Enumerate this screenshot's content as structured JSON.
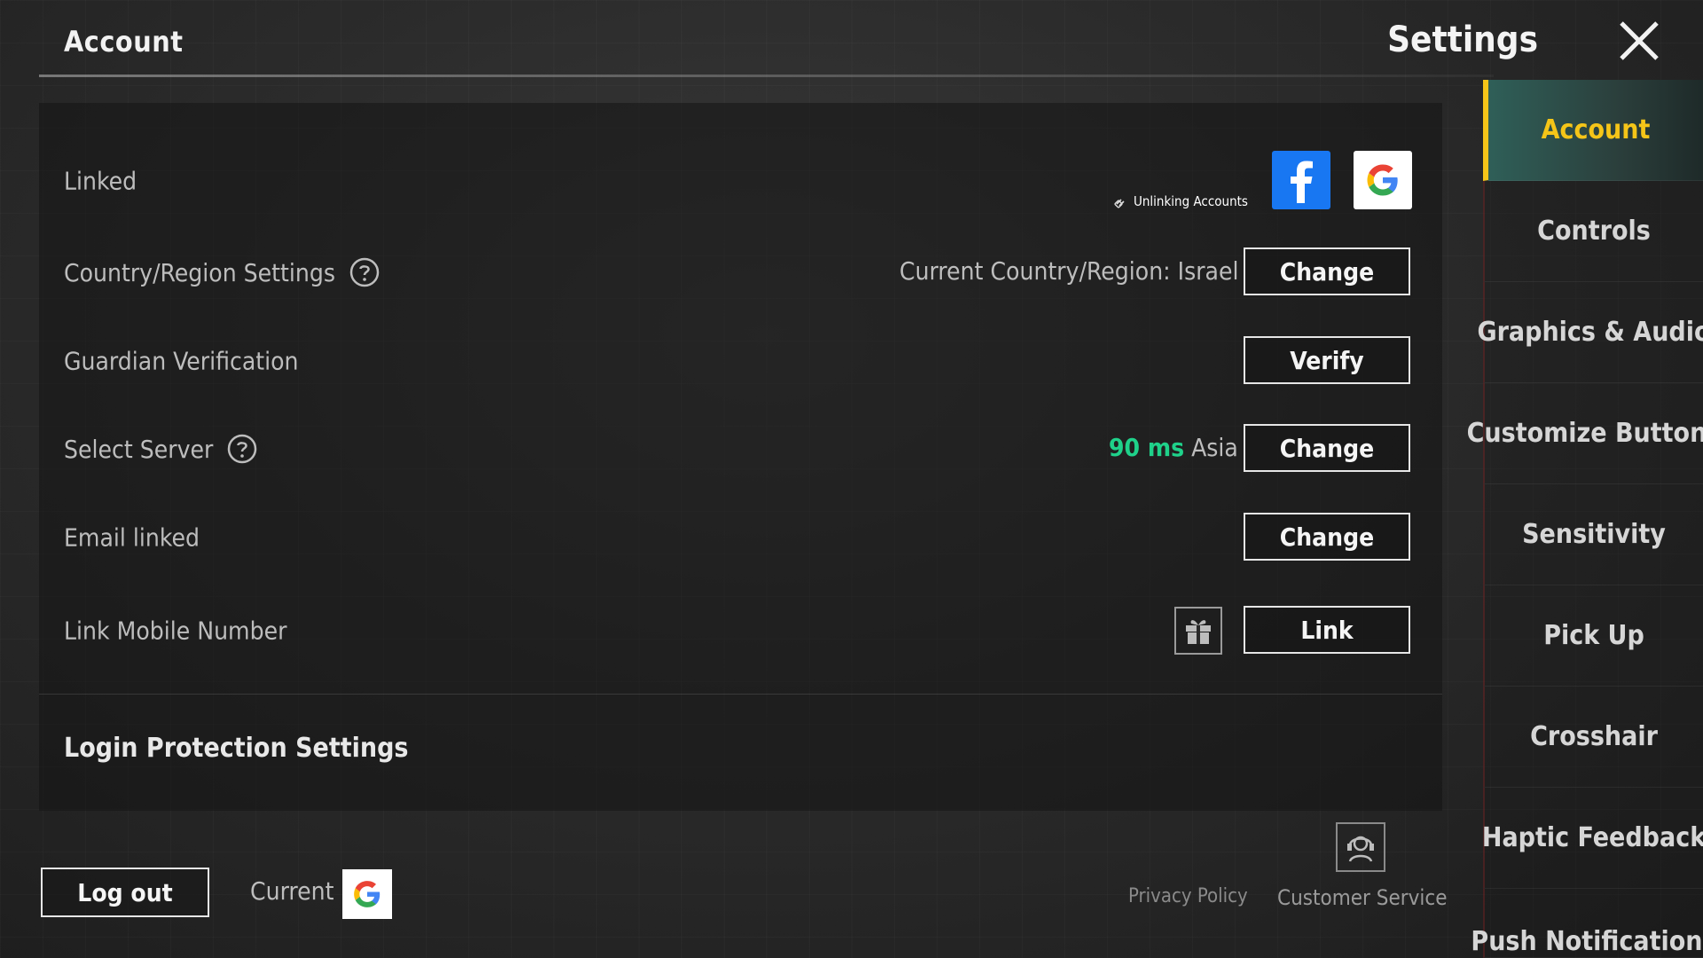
{
  "header": {
    "page_title": "Account",
    "settings_title": "Settings",
    "close_icon": "close-icon"
  },
  "account": {
    "linked": {
      "label": "Linked",
      "unlinking_accounts": "Unlinking Accounts",
      "providers": [
        "facebook-icon",
        "google-icon"
      ]
    },
    "country": {
      "label": "Country/Region Settings",
      "current": "Current Country/Region: Israel",
      "button": "Change"
    },
    "guardian": {
      "label": "Guardian Verification",
      "button": "Verify"
    },
    "server": {
      "label": "Select Server",
      "ping": "90 ms",
      "region": "Asia",
      "button": "Change",
      "ping_color": "#1fd18a"
    },
    "email": {
      "label": "Email linked",
      "button": "Change"
    },
    "mobile": {
      "label": "Link Mobile Number",
      "button": "Link",
      "gift_icon": "gift-icon"
    },
    "login_protection": "Login Protection Settings"
  },
  "footer": {
    "logout": "Log out",
    "current_label": "Current",
    "privacy_policy": "Privacy Policy",
    "customer_service": "Customer Service"
  },
  "sidebar": {
    "active_color": "#f5c518",
    "items": [
      {
        "label": "Account",
        "active": true
      },
      {
        "label": "Controls"
      },
      {
        "label": "Graphics & Audio"
      },
      {
        "label": "Customize Buttons"
      },
      {
        "label": "Sensitivity"
      },
      {
        "label": "Pick Up"
      },
      {
        "label": "Crosshair"
      },
      {
        "label": "Haptic Feedback"
      },
      {
        "label": "Push Notifications"
      }
    ]
  }
}
